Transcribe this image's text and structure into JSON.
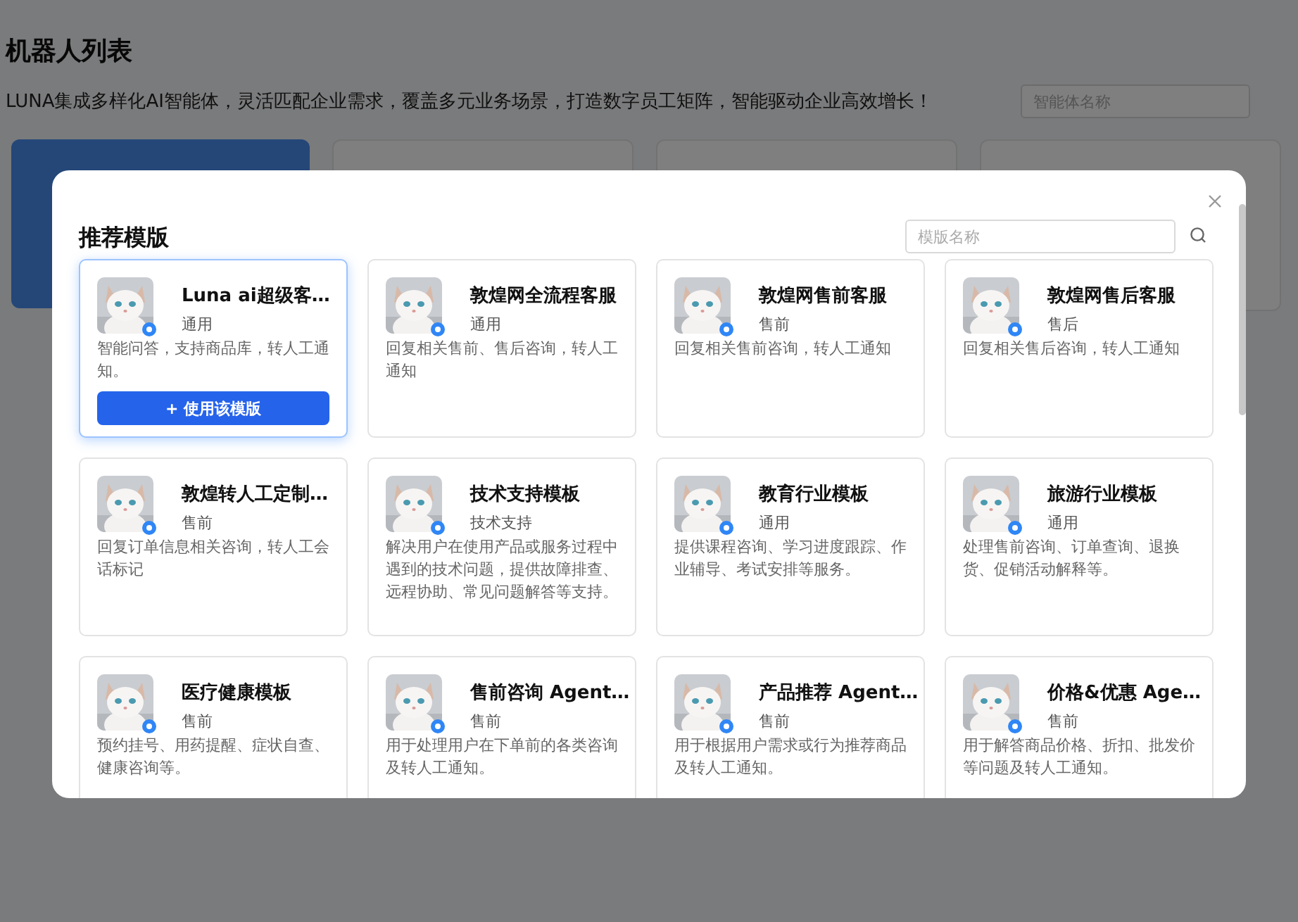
{
  "page": {
    "title": "机器人列表",
    "subtitle": "LUNA集成多样化AI智能体，灵活匹配企业需求，覆盖多元业务场景，打造数字员工矩阵，智能驱动企业高效增长！",
    "search": {
      "placeholder": "智能体名称"
    }
  },
  "dialog": {
    "title": "推荐模版",
    "search": {
      "placeholder": "模版名称"
    },
    "use_button": "+ 使用该模版",
    "templates": [
      {
        "name": "Luna ai超级客…",
        "tag": "通用",
        "description": "智能问答，支持商品库，转人工通知。",
        "selected": true
      },
      {
        "name": "敦煌网全流程客服",
        "tag": "通用",
        "description": "回复相关售前、售后咨询，转人工通知",
        "selected": false
      },
      {
        "name": "敦煌网售前客服",
        "tag": "售前",
        "description": "回复相关售前咨询，转人工通知",
        "selected": false
      },
      {
        "name": "敦煌网售后客服",
        "tag": "售后",
        "description": "回复相关售后咨询，转人工通知",
        "selected": false
      },
      {
        "name": "敦煌转人工定制…",
        "tag": "售前",
        "description": "回复订单信息相关咨询，转人工会话标记",
        "selected": false
      },
      {
        "name": "技术支持模板",
        "tag": "技术支持",
        "description": "解决用户在使用产品或服务过程中遇到的技术问题，提供故障排查、远程协助、常见问题解答等支持。",
        "selected": false
      },
      {
        "name": "教育行业模板",
        "tag": "通用",
        "description": "提供课程咨询、学习进度跟踪、作业辅导、考试安排等服务。",
        "selected": false
      },
      {
        "name": "旅游行业模板",
        "tag": "通用",
        "description": "处理售前咨询、订单查询、退换货、促销活动解释等。",
        "selected": false
      },
      {
        "name": "医疗健康模板",
        "tag": "售前",
        "description": "预约挂号、用药提醒、症状自查、健康咨询等。",
        "selected": false
      },
      {
        "name": "售前咨询 Agent…",
        "tag": "售前",
        "description": "用于处理用户在下单前的各类咨询及转人工通知。",
        "selected": false
      },
      {
        "name": "产品推荐 Agent…",
        "tag": "售前",
        "description": "用于根据用户需求或行为推荐商品及转人工通知。",
        "selected": false
      },
      {
        "name": "价格&优惠 Age…",
        "tag": "售前",
        "description": "用于解答商品价格、折扣、批发价等问题及转人工通知。",
        "selected": false
      }
    ]
  }
}
